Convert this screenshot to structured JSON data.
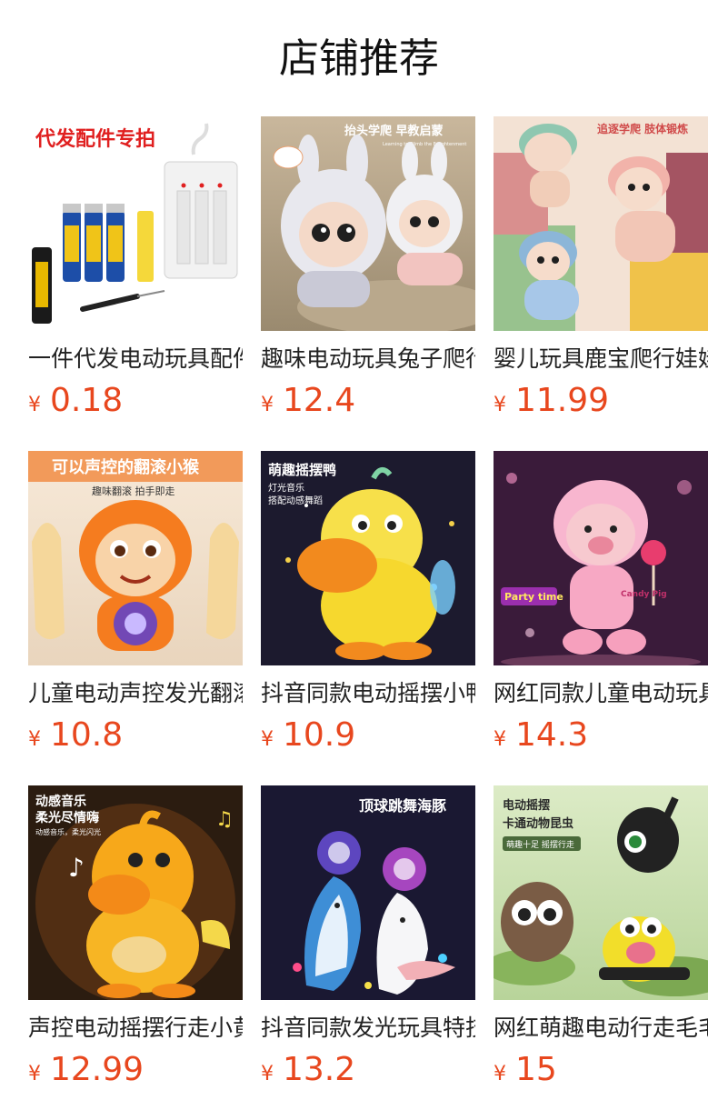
{
  "page_title": "店铺推荐",
  "currency": "¥",
  "products": [
    {
      "name": "一件代发电动玩具配件",
      "price": "0.18",
      "image_icon": "battery-charger-image",
      "banner": "代发配件专拍",
      "banner2": "",
      "banner3": ""
    },
    {
      "name": "趣味电动玩具兔子爬行娃娃",
      "price": "12.4",
      "image_icon": "bunny-doll-image",
      "banner": "抬头学爬 早教启蒙",
      "banner2": "Learning to Climb the Enlightenment",
      "banner3": ""
    },
    {
      "name": "婴儿玩具鹿宝爬行娃娃",
      "price": "11.99",
      "image_icon": "deer-doll-image",
      "banner": "追逐学爬 肢体锻炼",
      "banner2": "",
      "banner3": ""
    },
    {
      "name": "儿童电动声控发光翻滚小猴",
      "price": "10.8",
      "image_icon": "monkey-toy-image",
      "banner": "可以声控的翻滚小猴",
      "banner2": "趣味翻滚 拍手即走",
      "banner3": ""
    },
    {
      "name": "抖音同款电动摇摆小鸭",
      "price": "10.9",
      "image_icon": "duck-toy-image",
      "banner": "萌趣摇摆鸭",
      "banner2": "灯光音乐",
      "banner3": "搭配动感舞蹈"
    },
    {
      "name": "网红同款儿童电动玩具小猪",
      "price": "14.3",
      "image_icon": "pig-toy-image",
      "banner": "Party time",
      "banner2": "Candy Pig",
      "banner3": ""
    },
    {
      "name": "声控电动摇摆行走小黄鸭",
      "price": "12.99",
      "image_icon": "yellow-duck-image",
      "banner": "动感音乐",
      "banner2": "柔光尽情嗨",
      "banner3": "动感音乐，柔光闪光"
    },
    {
      "name": "抖音同款发光玩具特技海豚",
      "price": "13.2",
      "image_icon": "dolphin-toy-image",
      "banner": "顶球跳舞海豚",
      "banner2": "",
      "banner3": ""
    },
    {
      "name": "网红萌趣电动行走毛毛虫",
      "price": "15",
      "image_icon": "insect-toy-image",
      "banner": "电动摇摆",
      "banner2": "卡通动物昆虫",
      "banner3": "萌趣十足 摇摆行走"
    }
  ]
}
